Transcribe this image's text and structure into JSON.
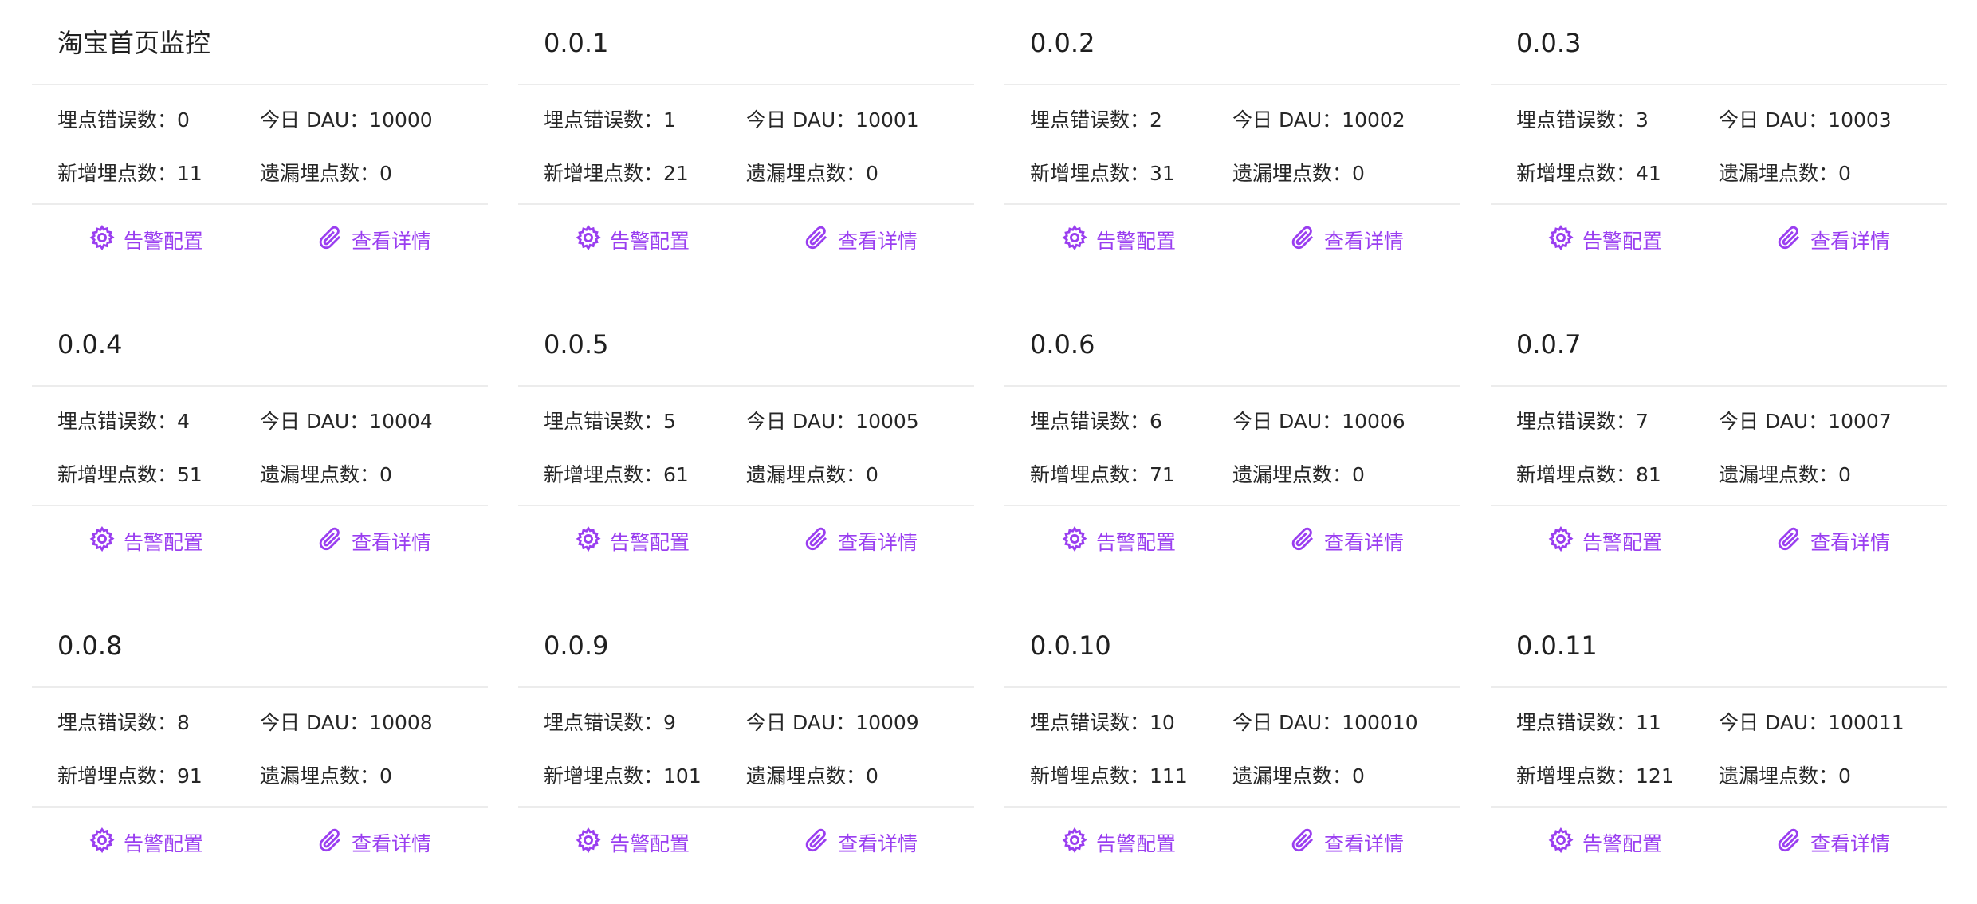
{
  "labels": {
    "errors": "埋点错误数：",
    "dau": "今日 DAU：",
    "added": "新增埋点数：",
    "missing": "遗漏埋点数：",
    "alert_config": "告警配置",
    "view_details": "查看详情"
  },
  "accent_color": "#9a3ef0",
  "icons": {
    "alert_config": "gear-icon",
    "view_details": "paperclip-icon"
  },
  "cards": [
    {
      "title": "淘宝首页监控",
      "errors": "0",
      "dau": "10000",
      "added": "11",
      "missing": "0"
    },
    {
      "title": "0.0.1",
      "errors": "1",
      "dau": "10001",
      "added": "21",
      "missing": "0"
    },
    {
      "title": "0.0.2",
      "errors": "2",
      "dau": "10002",
      "added": "31",
      "missing": "0"
    },
    {
      "title": "0.0.3",
      "errors": "3",
      "dau": "10003",
      "added": "41",
      "missing": "0"
    },
    {
      "title": "0.0.4",
      "errors": "4",
      "dau": "10004",
      "added": "51",
      "missing": "0"
    },
    {
      "title": "0.0.5",
      "errors": "5",
      "dau": "10005",
      "added": "61",
      "missing": "0"
    },
    {
      "title": "0.0.6",
      "errors": "6",
      "dau": "10006",
      "added": "71",
      "missing": "0"
    },
    {
      "title": "0.0.7",
      "errors": "7",
      "dau": "10007",
      "added": "81",
      "missing": "0"
    },
    {
      "title": "0.0.8",
      "errors": "8",
      "dau": "10008",
      "added": "91",
      "missing": "0"
    },
    {
      "title": "0.0.9",
      "errors": "9",
      "dau": "10009",
      "added": "101",
      "missing": "0"
    },
    {
      "title": "0.0.10",
      "errors": "10",
      "dau": "100010",
      "added": "111",
      "missing": "0"
    },
    {
      "title": "0.0.11",
      "errors": "11",
      "dau": "100011",
      "added": "121",
      "missing": "0"
    }
  ]
}
